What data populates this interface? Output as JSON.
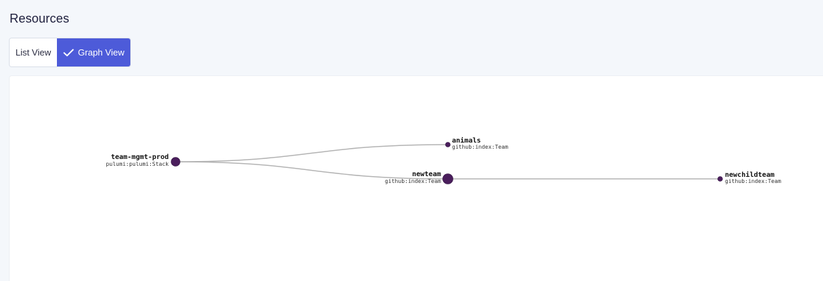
{
  "header": {
    "title": "Resources"
  },
  "view_toggle": {
    "list_label": "List View",
    "graph_label": "Graph View",
    "selected": "Graph View",
    "check_icon": "check-icon"
  },
  "colors": {
    "accent": "#4d5bd9",
    "node": "#4a1e5c",
    "edge": "#b3b3b3"
  },
  "graph": {
    "nodes": [
      {
        "id": "team-mgmt-prod",
        "name": "team-mgmt-prod",
        "type": "pulumi:pulumi:Stack"
      },
      {
        "id": "animals",
        "name": "animals",
        "type": "github:index:Team"
      },
      {
        "id": "newteam",
        "name": "newteam",
        "type": "github:index:Team"
      },
      {
        "id": "newchildteam",
        "name": "newchildteam",
        "type": "github:index:Team"
      }
    ],
    "edges": [
      {
        "from": "team-mgmt-prod",
        "to": "animals"
      },
      {
        "from": "team-mgmt-prod",
        "to": "newteam"
      },
      {
        "from": "newteam",
        "to": "newchildteam"
      }
    ]
  }
}
